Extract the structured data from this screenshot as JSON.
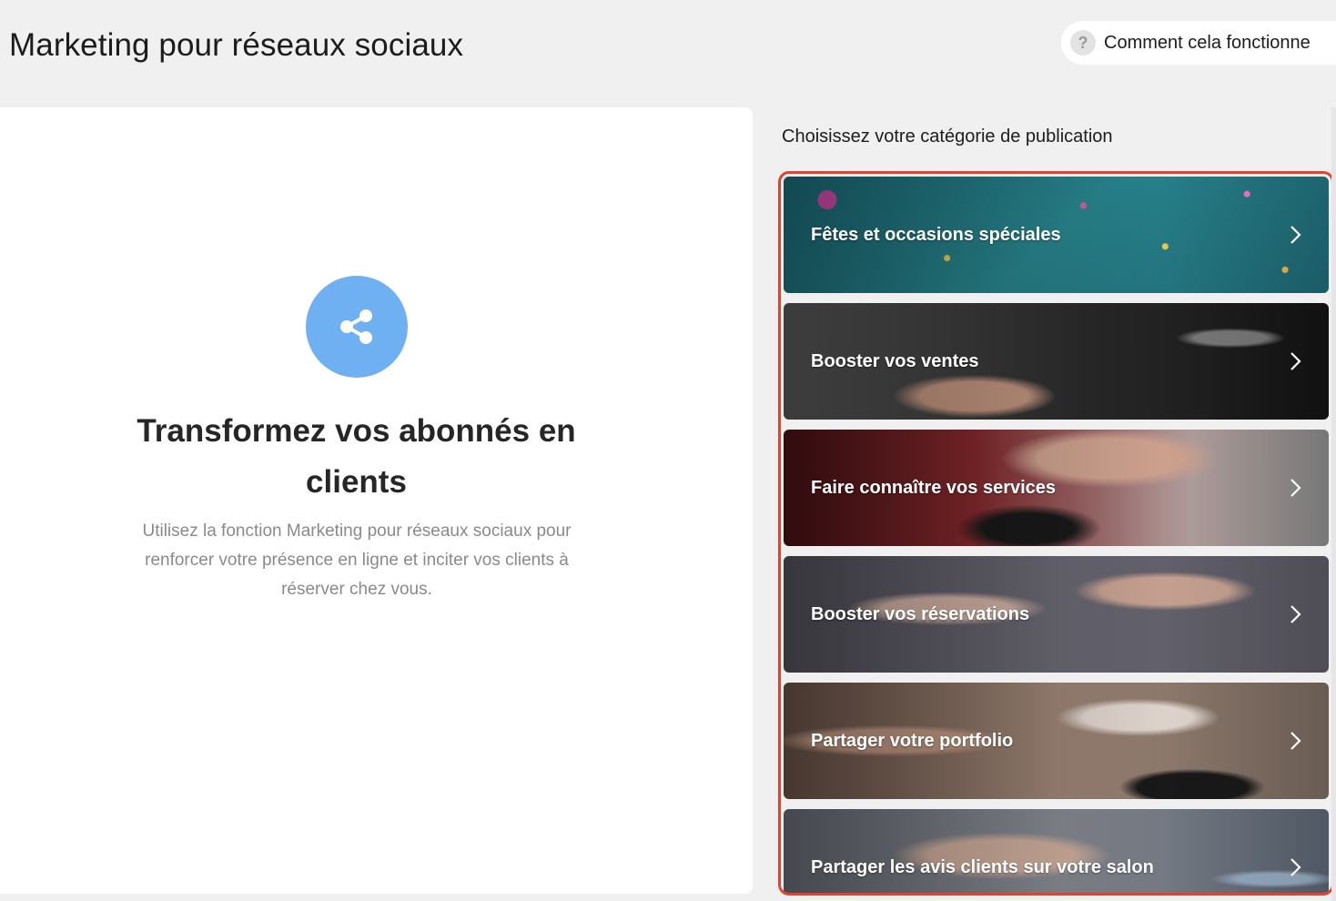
{
  "header": {
    "title": "Marketing pour réseaux sociaux",
    "help_icon": "?",
    "help_label": "Comment cela fonctionne"
  },
  "hero": {
    "icon": "share-icon",
    "heading": "Transformez vos abonnés en clients",
    "description": "Utilisez la fonction Marketing pour réseaux sociaux pour renforcer votre présence en ligne et inciter vos clients à réserver chez vous."
  },
  "categories": {
    "heading": "Choisissez votre catégorie de publication",
    "highlight_color": "#e2432e",
    "items": [
      {
        "label": "Fêtes et occasions spéciales"
      },
      {
        "label": "Booster vos ventes"
      },
      {
        "label": "Faire connaître vos services"
      },
      {
        "label": "Booster vos réservations"
      },
      {
        "label": "Partager votre portfolio"
      },
      {
        "label": "Partager les avis clients sur votre salon"
      }
    ]
  },
  "colors": {
    "accent_blue": "#6fb0f2",
    "background": "#f0f0f0"
  }
}
